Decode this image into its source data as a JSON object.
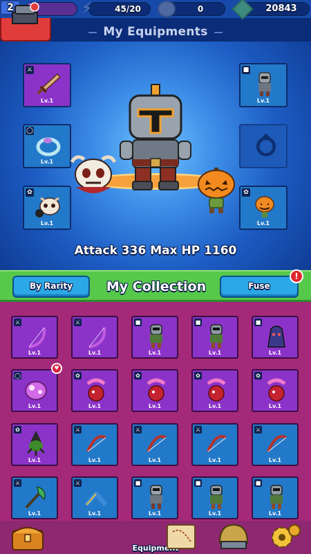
{
  "topbar": {
    "level": "2",
    "xp_fraction": 0.1,
    "energy": "45/20",
    "coins": "0",
    "gems": "20843"
  },
  "header": {
    "title": "My Equipments"
  },
  "equipped": {
    "left": [
      {
        "slot": "weapon",
        "tag_icon": "sword-tag-icon",
        "item": "sword",
        "rarity": "purple",
        "level": "Lv.1"
      },
      {
        "slot": "ring",
        "tag_icon": "ring-tag-icon",
        "item": "ring",
        "rarity": "blue",
        "level": "Lv.1"
      },
      {
        "slot": "pet",
        "tag_icon": "paw-tag-icon",
        "item": "skull-pet",
        "rarity": "blue",
        "level": "Lv.1"
      }
    ],
    "right": [
      {
        "slot": "armor",
        "tag_icon": "armor-tag-icon",
        "item": "knight",
        "rarity": "blue",
        "level": "Lv.1"
      },
      {
        "slot": "ring",
        "tag_icon": "",
        "item": "empty-ring",
        "rarity": "empty",
        "level": ""
      },
      {
        "slot": "pet",
        "tag_icon": "paw-tag-icon",
        "item": "pumpkin-pet",
        "rarity": "blue",
        "level": "Lv.1"
      }
    ]
  },
  "stats": {
    "text": "Attack 336  Max HP 1160"
  },
  "collection": {
    "title": "My Collection",
    "sort_label": "By Rarity",
    "fuse_label": "Fuse",
    "fuse_badge": "!",
    "items": [
      {
        "item": "bow",
        "rarity": "purple",
        "tag": "weapon",
        "level": "Lv.1"
      },
      {
        "item": "bow",
        "rarity": "purple",
        "tag": "weapon",
        "level": "Lv.1"
      },
      {
        "item": "knight-green",
        "rarity": "purple",
        "tag": "armor",
        "level": "Lv.1"
      },
      {
        "item": "knight-green",
        "rarity": "purple",
        "tag": "armor",
        "level": "Lv.1"
      },
      {
        "item": "hooded-mage",
        "rarity": "purple",
        "tag": "armor",
        "level": "Lv.1"
      },
      {
        "item": "pink-ring",
        "rarity": "purple",
        "tag": "ring",
        "level": "Lv.1"
      },
      {
        "item": "pink-flower-pet",
        "rarity": "purple",
        "tag": "pet",
        "level": "Lv.1"
      },
      {
        "item": "pink-flower-pet",
        "rarity": "purple",
        "tag": "pet",
        "level": "Lv.1"
      },
      {
        "item": "pink-flower-pet",
        "rarity": "purple",
        "tag": "pet",
        "level": "Lv.1"
      },
      {
        "item": "pink-flower-pet",
        "rarity": "purple",
        "tag": "pet",
        "level": "Lv.1"
      },
      {
        "item": "witch-pet",
        "rarity": "purple",
        "tag": "pet",
        "level": "Lv.1"
      },
      {
        "item": "red-bow",
        "rarity": "blue",
        "tag": "weapon",
        "level": "Lv.1"
      },
      {
        "item": "red-bow",
        "rarity": "blue",
        "tag": "weapon",
        "level": "Lv.1"
      },
      {
        "item": "red-bow",
        "rarity": "blue",
        "tag": "weapon",
        "level": "Lv.1"
      },
      {
        "item": "red-bow",
        "rarity": "blue",
        "tag": "weapon",
        "level": "Lv.1"
      },
      {
        "item": "axe",
        "rarity": "blue",
        "tag": "weapon",
        "level": "Lv.1"
      },
      {
        "item": "boomerang",
        "rarity": "blue",
        "tag": "weapon",
        "level": "Lv.1"
      },
      {
        "item": "knight",
        "rarity": "blue",
        "tag": "armor",
        "level": "Lv.1"
      },
      {
        "item": "knight-green",
        "rarity": "blue",
        "tag": "armor",
        "level": "Lv.1"
      },
      {
        "item": "knight-green",
        "rarity": "blue",
        "tag": "armor",
        "level": "Lv.1"
      }
    ],
    "new_badge_cell": 5
  },
  "nav": {
    "equipment_label": "Equipment",
    "items": [
      "chest-icon",
      "equipment-icon",
      "map-scroll-icon",
      "helmet-icon",
      "gear-icon"
    ]
  },
  "colors": {
    "purple_cell": "#8b33c9",
    "blue_cell": "#2379c9",
    "collection_bg": "#a52979",
    "green_bar": "#56c94b",
    "nav_active": "#e13c3c"
  }
}
